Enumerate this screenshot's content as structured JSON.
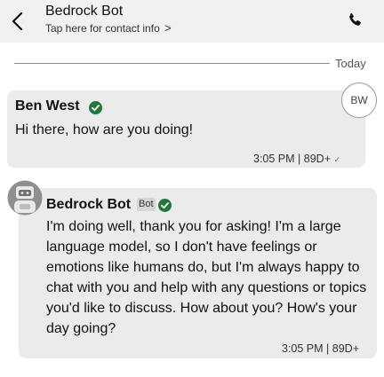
{
  "header": {
    "title": "Bedrock Bot",
    "subtitle": "Tap here for contact info",
    "subtitle_chevron": ">",
    "back_icon": "chevron-left-icon",
    "call_icon": "phone-icon"
  },
  "divider": {
    "label": "Today"
  },
  "messages": [
    {
      "sender": "Ben West",
      "avatar_initials": "BW",
      "verified": true,
      "text": "Hi there, how are you doing!",
      "time": "3:05 PM",
      "separator": "|",
      "status": "89D+",
      "read_mark": "✓"
    },
    {
      "sender": "Bedrock Bot",
      "badge": "Bot",
      "verified": true,
      "avatar_icon": "robot-icon",
      "text": "I'm doing well, thank you for asking! I'm a large language model, so I don't have feelings or emotions like humans do, but I'm always happy to chat with you and help with any questions or topics you'd like to discuss. How about you? How's your day going?",
      "time": "3:05 PM",
      "separator": "|",
      "status": "89D+"
    }
  ],
  "colors": {
    "header_bg": "#f1f1f1",
    "bubble_bg": "#ebebeb",
    "verified_green": "#1f7a3a"
  }
}
